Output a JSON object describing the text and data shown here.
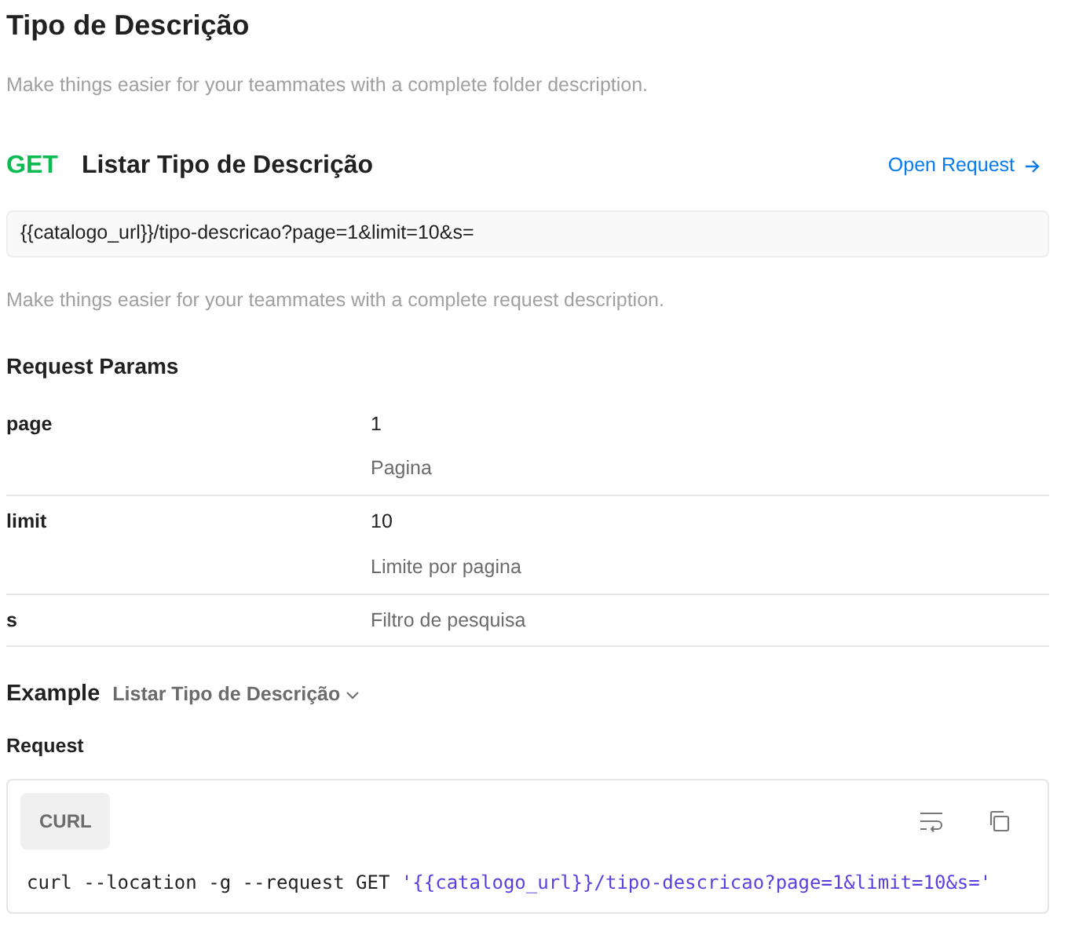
{
  "folder": {
    "title": "Tipo de Descrição",
    "description": "Make things easier for your teammates with a complete folder description."
  },
  "request": {
    "method": "GET",
    "name": "Listar Tipo de Descrição",
    "open_link": "Open Request",
    "url": "{{catalogo_url}}/tipo-descricao?page=1&limit=10&s=",
    "description": "Make things easier for your teammates with a complete request description."
  },
  "params": {
    "title": "Request Params",
    "rows": [
      {
        "name": "page",
        "value": "1",
        "description": "Pagina"
      },
      {
        "name": "limit",
        "value": "10",
        "description": "Limite por pagina"
      },
      {
        "name": "s",
        "description": "Filtro de pesquisa"
      }
    ]
  },
  "example": {
    "title": "Example",
    "selector": "Listar Tipo de Descrição",
    "subtitle": "Request",
    "tab": "CURL",
    "code_command": "curl --location -g --request GET ",
    "code_string": "'{{catalogo_url}}/tipo-descricao?page=1&limit=10&s='"
  }
}
